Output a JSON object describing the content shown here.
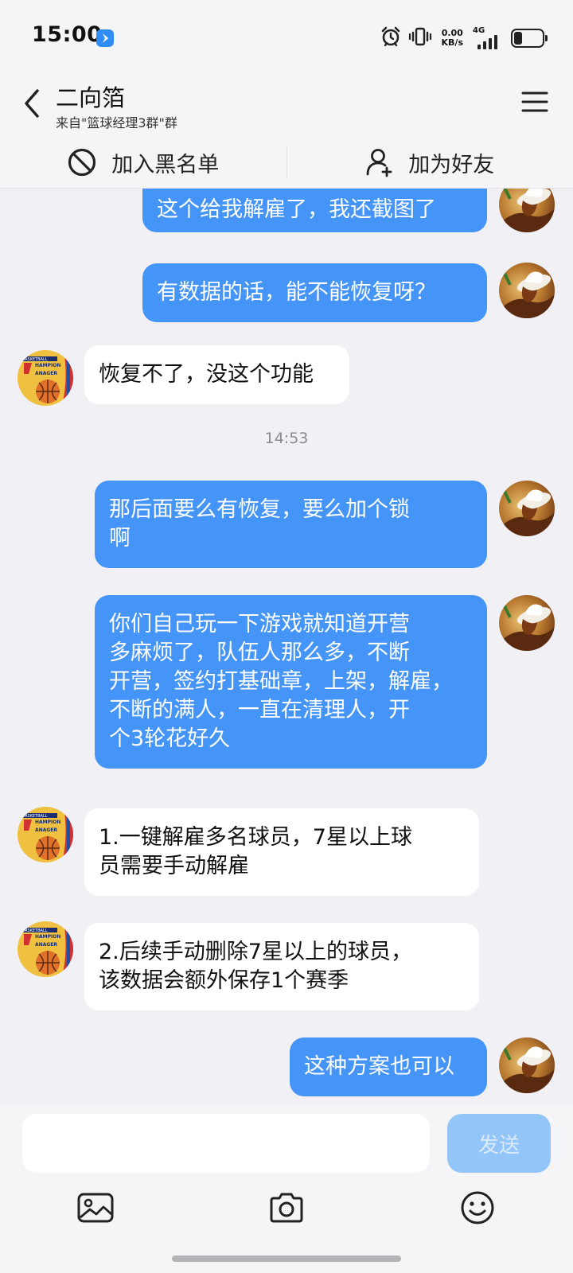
{
  "status_bar": {
    "time": "15:00",
    "net_speed_value": "0.00",
    "net_speed_unit": "KB/s",
    "network_type": "4G",
    "battery_level": 0.3
  },
  "header": {
    "title": "二向箔",
    "subtitle": "来自\"篮球经理3群\"群"
  },
  "actions": {
    "blacklist_label": "加入黑名单",
    "add_friend_label": "加为好友"
  },
  "messages": [
    {
      "sender": "me",
      "text": "这个给我解雇了，我还截图了"
    },
    {
      "sender": "me",
      "text": "有数据的话，能不能恢复呀？"
    },
    {
      "sender": "them",
      "text": "恢复不了，没这个功能"
    },
    {
      "sender": "me",
      "lines": [
        "那后面要么有恢复，要么加个锁",
        "啊"
      ]
    },
    {
      "sender": "me",
      "lines": [
        "你们自己玩一下游戏就知道开营",
        "多麻烦了，队伍人那么多，不断",
        "开营，签约打基础章，上架，解雇，",
        "不断的满人，一直在清理人，开",
        "个3轮花好久"
      ]
    },
    {
      "sender": "them",
      "lines": [
        "1.一键解雇多名球员，7星以上球",
        "员需要手动解雇"
      ]
    },
    {
      "sender": "them",
      "lines": [
        "2.后续手动删除7星以上的球员，",
        "该数据会额外保存1个赛季"
      ]
    },
    {
      "sender": "me",
      "text": "这种方案也可以"
    }
  ],
  "timestamp": "14:53",
  "input": {
    "value": "",
    "send_label": "发送"
  },
  "avatar_logo": {
    "line1": "ASKETBALL",
    "line2": "HAMPION",
    "line3": "ANAGER"
  },
  "colors": {
    "my_bubble": "#4594f7",
    "their_bubble": "#ffffff",
    "background": "#f0f0f5",
    "send_button_disabled": "#93c5f8"
  }
}
